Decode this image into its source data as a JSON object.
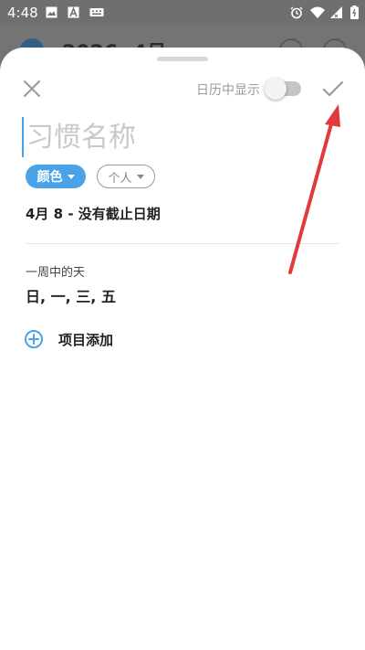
{
  "status_bar": {
    "time": "4:48",
    "left_icons": [
      "image-icon",
      "a-icon",
      "keyboard-icon"
    ],
    "right_icons": [
      "alarm-icon",
      "wifi-icon",
      "signal-icon",
      "battery-icon"
    ]
  },
  "background_app": {
    "title": "2026. 4月 ▾"
  },
  "sheet": {
    "show_in_calendar_label": "日历中显示",
    "show_in_calendar_on": false,
    "name_placeholder": "习惯名称",
    "color_chip_label": "颜色",
    "personal_chip_label": "个人",
    "date_line": "4月 8 - 没有截止日期",
    "week_label": "一周中的天",
    "week_days": "日, 一, 三, 五",
    "add_item_label": "项目添加"
  },
  "colors": {
    "accent": "#4aa3e8",
    "annotation_arrow": "#e03a3a"
  }
}
